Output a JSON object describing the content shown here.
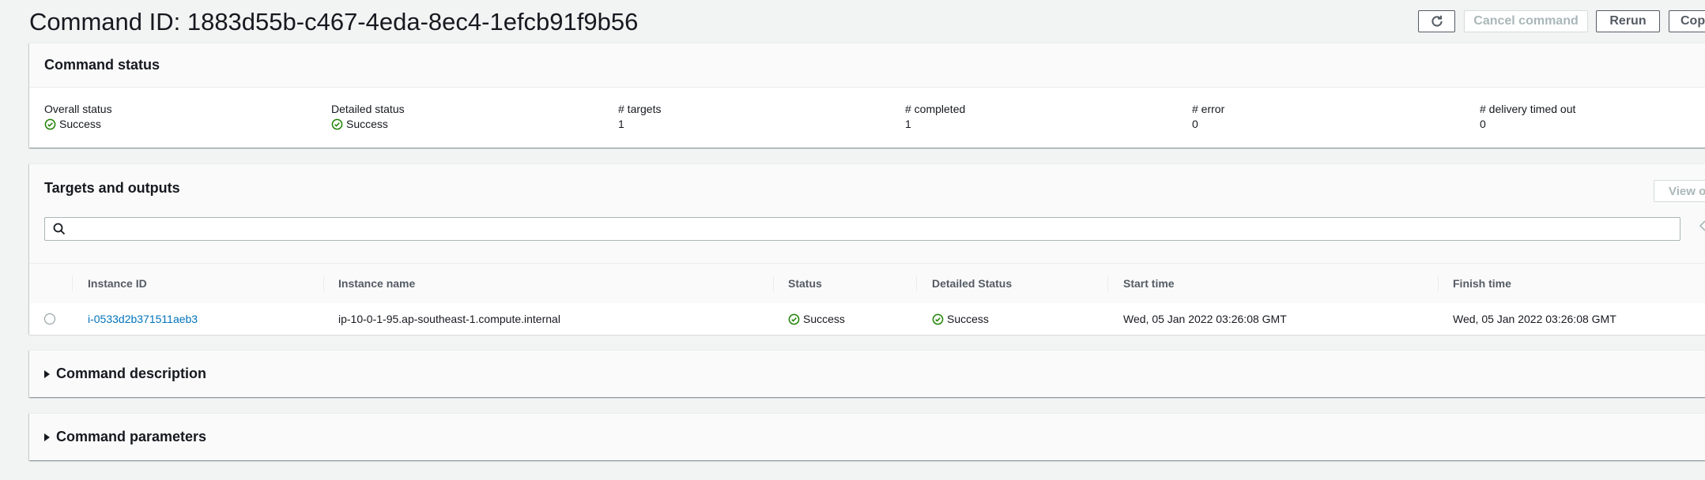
{
  "header": {
    "title": "Command ID: 1883d55b-c467-4eda-8ec4-1efcb91f9b56",
    "refresh_icon": "refresh-icon",
    "cancel_label": "Cancel command",
    "rerun_label": "Rerun",
    "copy_label": "Cop"
  },
  "status": {
    "title": "Command status",
    "items": [
      {
        "label": "Overall status",
        "value": "Success",
        "is_status": true
      },
      {
        "label": "Detailed status",
        "value": "Success",
        "is_status": true
      },
      {
        "label": "# targets",
        "value": "1"
      },
      {
        "label": "# completed",
        "value": "1"
      },
      {
        "label": "# error",
        "value": "0"
      },
      {
        "label": "# delivery timed out",
        "value": "0"
      }
    ]
  },
  "targets": {
    "title": "Targets and outputs",
    "view_label": "View o",
    "search_placeholder": "",
    "columns": [
      "Instance ID",
      "Instance name",
      "Status",
      "Detailed Status",
      "Start time",
      "Finish time"
    ],
    "rows": [
      {
        "instance_id": "i-0533d2b371511aeb3",
        "instance_name": "ip-10-0-1-95.ap-southeast-1.compute.internal",
        "status": "Success",
        "detailed_status": "Success",
        "start_time": "Wed, 05 Jan 2022 03:26:08 GMT",
        "finish_time": "Wed, 05 Jan 2022 03:26:08 GMT"
      }
    ]
  },
  "description": {
    "title": "Command description"
  },
  "parameters": {
    "title": "Command parameters"
  },
  "colors": {
    "success": "#1d8102",
    "link": "#0073bb",
    "page_bg": "#f2f3f3"
  }
}
